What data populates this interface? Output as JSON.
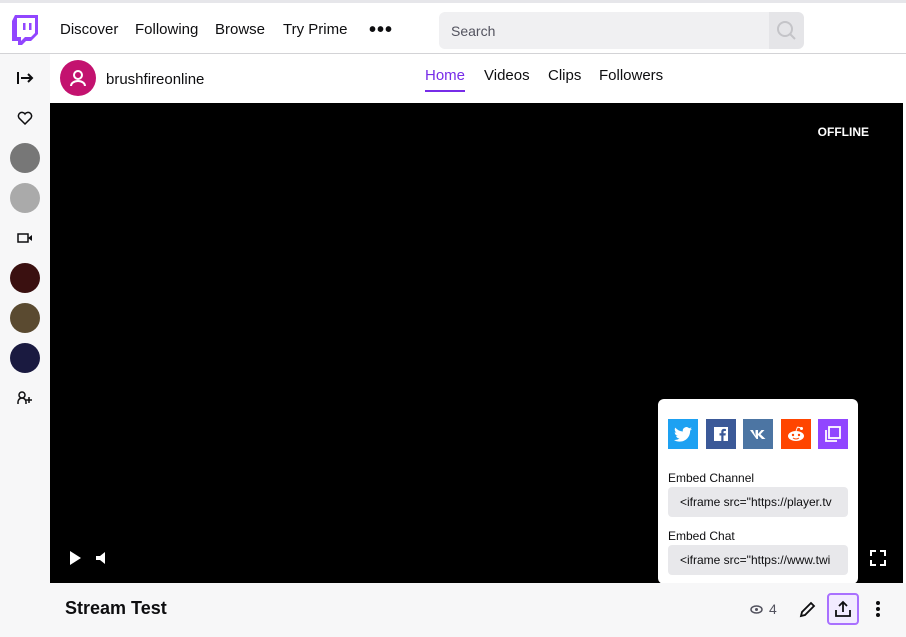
{
  "topnav": {
    "links": [
      "Discover",
      "Following",
      "Browse",
      "Try Prime"
    ],
    "more": "•••",
    "search_placeholder": "Search"
  },
  "channel": {
    "name": "brushfireonline",
    "tabs": [
      "Home",
      "Videos",
      "Clips",
      "Followers"
    ],
    "active_tab": "Home"
  },
  "player": {
    "status": "OFFLINE"
  },
  "stream": {
    "title": "Stream Test",
    "viewers": "4"
  },
  "share_popup": {
    "services": [
      "twitter",
      "facebook",
      "vk",
      "reddit",
      "copy"
    ],
    "embed_channel_label": "Embed Channel",
    "embed_channel_value": "<iframe src=\"https://player.tv",
    "embed_chat_label": "Embed Chat",
    "embed_chat_value": "<iframe src=\"https://www.twi"
  },
  "colors": {
    "accent": "#772ce8",
    "avatar": "#c3126f",
    "twitter": "#1da1f2",
    "facebook": "#3b5998",
    "vk": "#4c75a3",
    "reddit": "#ff4500",
    "copy": "#9146ff"
  }
}
